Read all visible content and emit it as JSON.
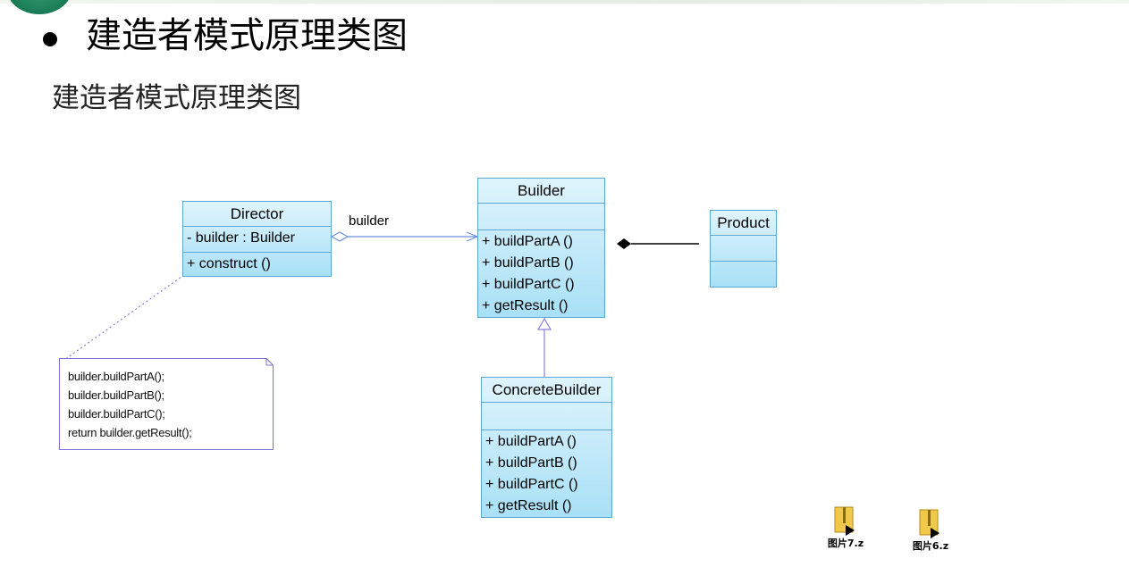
{
  "slide": {
    "heading": "建造者模式原理类图",
    "subheading": "建造者模式原理类图"
  },
  "diagram": {
    "director": {
      "name": "Director",
      "attributes": [
        "- builder : Builder"
      ],
      "operations": [
        "+ construct ()"
      ]
    },
    "builder": {
      "name": "Builder",
      "operations": [
        "+ buildPartA ()",
        "+ buildPartB ()",
        "+ buildPartC ()",
        "+ getResult ()"
      ]
    },
    "product": {
      "name": "Product"
    },
    "concrete_builder": {
      "name": "ConcreteBuilder",
      "operations": [
        "+ buildPartA ()",
        "+ buildPartB ()",
        "+ buildPartC ()",
        "+ getResult ()"
      ]
    },
    "association_label": "builder",
    "note_lines": [
      "builder.buildPartA();",
      "builder.buildPartB();",
      "builder.buildPartC();",
      "return builder.getResult();"
    ]
  },
  "files": [
    {
      "name": "图片7.z",
      "icon": "zip-folder-icon"
    },
    {
      "name": "图片6.z",
      "icon": "zip-folder-icon"
    }
  ],
  "colors": {
    "class_fill_top": "#dff4fd",
    "class_fill_bottom": "#a9e0f6",
    "class_border": "#5aa8d3",
    "note_border": "#7b73d6",
    "connector": "#6a8fe0"
  }
}
